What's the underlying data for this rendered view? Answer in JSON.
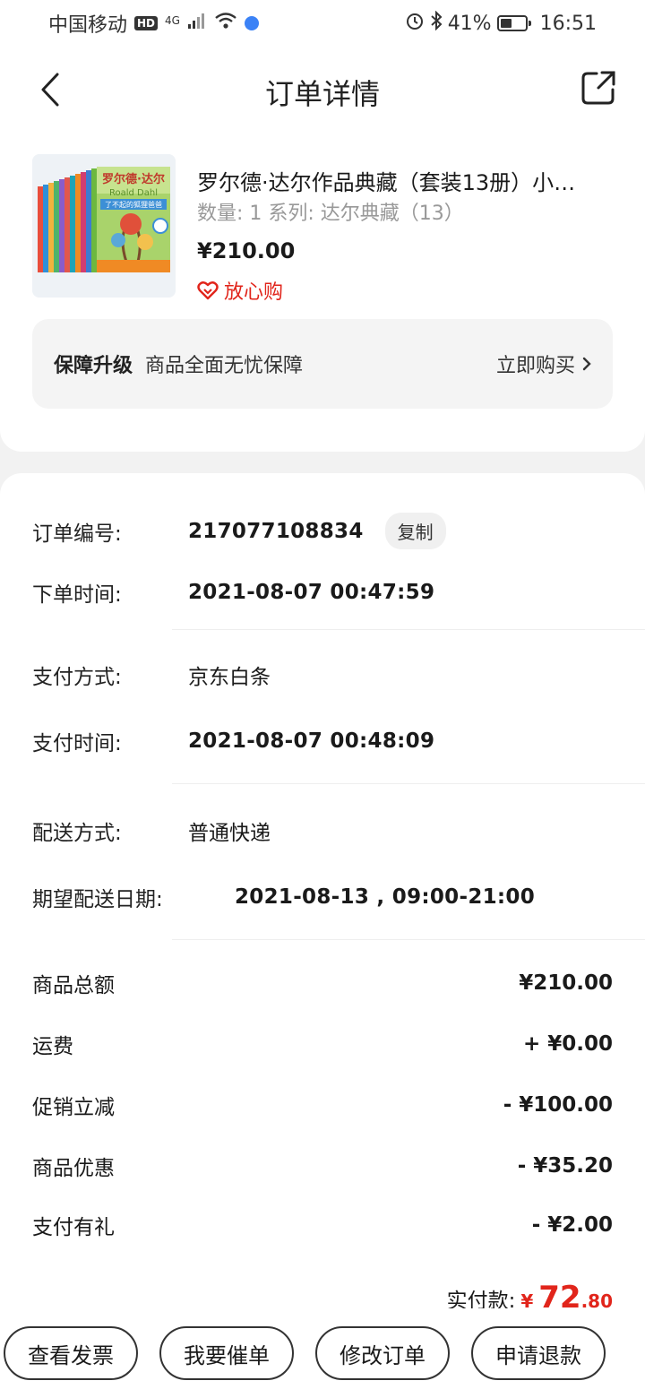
{
  "status_bar": {
    "carrier": "中国移动",
    "hd": "HD",
    "network": "4G",
    "battery": "41%",
    "time": "16:51"
  },
  "nav": {
    "title": "订单详情"
  },
  "product": {
    "title": "罗尔德·达尔作品典藏（套装13册）小…",
    "meta": "数量: 1  系列: 达尔典藏（13）",
    "price": "¥210.00",
    "tag": "放心购",
    "cover_title": "罗尔德·达尔",
    "cover_en": "Roald Dahl",
    "cover_subtitle": "了不起的狐狸爸爸"
  },
  "guarantee": {
    "label": "保障升级",
    "text": "商品全面无忧保障",
    "action": "立即购买"
  },
  "order": {
    "number_label": "订单编号:",
    "number": "217077108834",
    "copy": "复制",
    "order_time_label": "下单时间:",
    "order_time": "2021-08-07 00:47:59",
    "pay_method_label": "支付方式:",
    "pay_method": "京东白条",
    "pay_time_label": "支付时间:",
    "pay_time": "2021-08-07 00:48:09",
    "delivery_label": "配送方式:",
    "delivery": "普通快递",
    "expected_label": "期望配送日期:",
    "expected": "2021-08-13 , 09:00-21:00"
  },
  "summary": [
    {
      "label": "商品总额",
      "amount": "¥210.00"
    },
    {
      "label": "运费",
      "amount": "+ ¥0.00"
    },
    {
      "label": "促销立减",
      "amount": "- ¥100.00"
    },
    {
      "label": "商品优惠",
      "amount": "- ¥35.20"
    },
    {
      "label": "支付有礼",
      "amount": "- ¥2.00"
    }
  ],
  "total": {
    "label": "实付款:",
    "currency": "¥",
    "integer": "72",
    "decimal": ".80"
  },
  "actions": [
    "查看发票",
    "我要催单",
    "修改订单",
    "申请退款"
  ],
  "colors": {
    "accent_red": "#e1251b",
    "background": "#f2f2f2"
  }
}
